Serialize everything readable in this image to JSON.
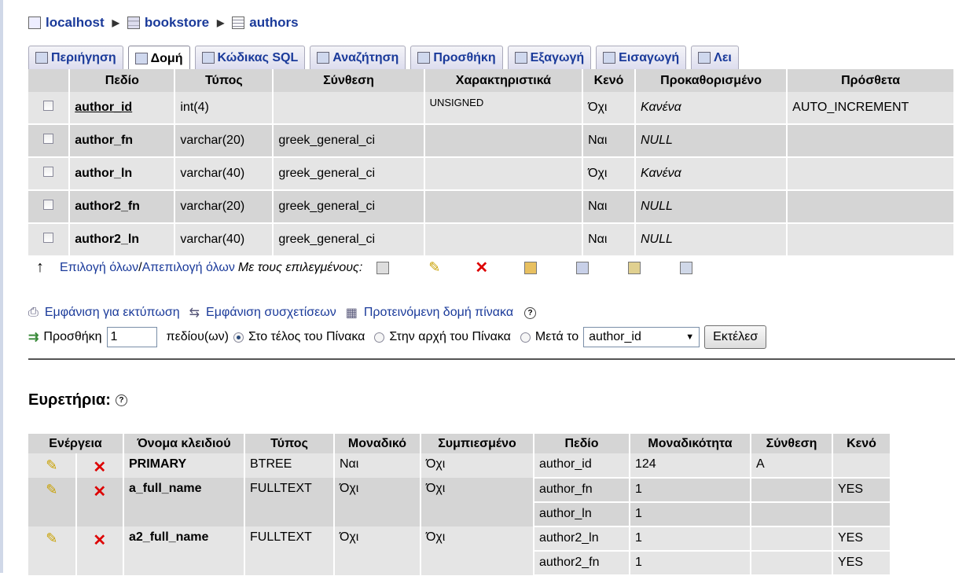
{
  "breadcrumb": {
    "server": "localhost",
    "database": "bookstore",
    "table": "authors"
  },
  "tabs": [
    {
      "label": "Περιήγηση",
      "icon": "browse-icon"
    },
    {
      "label": "Δομή",
      "icon": "structure-icon",
      "active": true
    },
    {
      "label": "Κώδικας SQL",
      "icon": "sql-icon"
    },
    {
      "label": "Αναζήτηση",
      "icon": "search-icon"
    },
    {
      "label": "Προσθήκη",
      "icon": "insert-icon"
    },
    {
      "label": "Εξαγωγή",
      "icon": "export-icon"
    },
    {
      "label": "Εισαγωγή",
      "icon": "import-icon"
    },
    {
      "label": "Λει",
      "icon": "operations-icon"
    }
  ],
  "structure": {
    "headers": [
      "Πεδίο",
      "Τύπος",
      "Σύνθεση",
      "Χαρακτηριστικά",
      "Κενό",
      "Προκαθορισμένο",
      "Πρόσθετα"
    ],
    "rows": [
      {
        "field": "author_id",
        "type": "int(4)",
        "collation": "",
        "attributes": "UNSIGNED",
        "null": "Όχι",
        "default": "Κανένα",
        "extra": "AUTO_INCREMENT"
      },
      {
        "field": "author_fn",
        "type": "varchar(20)",
        "collation": "greek_general_ci",
        "attributes": "",
        "null": "Ναι",
        "default": "NULL",
        "extra": ""
      },
      {
        "field": "author_ln",
        "type": "varchar(40)",
        "collation": "greek_general_ci",
        "attributes": "",
        "null": "Όχι",
        "default": "Κανένα",
        "extra": ""
      },
      {
        "field": "author2_fn",
        "type": "varchar(20)",
        "collation": "greek_general_ci",
        "attributes": "",
        "null": "Ναι",
        "default": "NULL",
        "extra": ""
      },
      {
        "field": "author2_ln",
        "type": "varchar(40)",
        "collation": "greek_general_ci",
        "attributes": "",
        "null": "Ναι",
        "default": "NULL",
        "extra": ""
      }
    ]
  },
  "actions": {
    "select_all": "Επιλογή όλων",
    "separator": " / ",
    "deselect_all": "Απεπιλογή όλων",
    "with_selected": "Με τους επιλεγμένους:"
  },
  "links": {
    "print": "Εμφάνιση για εκτύπωση",
    "relations": "Εμφάνιση συσχετίσεων",
    "propose": "Προτεινόμενη δομή πίνακα"
  },
  "add_fields": {
    "label": "Προσθήκη",
    "count": "1",
    "fields_label": "πεδίου(ων)",
    "at_end": "Στο τέλος του Πίνακα",
    "at_start": "Στην αρχή του Πίνακα",
    "after": "Μετά το",
    "after_field": "author_id",
    "go": "Εκτέλεσ"
  },
  "indexes": {
    "title": "Ευρετήρια:",
    "headers": [
      "Ενέργεια",
      "Όνομα κλειδιού",
      "Τύπος",
      "Μοναδικό",
      "Συμπιεσμένο",
      "Πεδίο",
      "Μοναδικότητα",
      "Σύνθεση",
      "Κενό"
    ],
    "rows": [
      {
        "name": "PRIMARY",
        "type": "BTREE",
        "unique": "Ναι",
        "packed": "Όχι",
        "fields": [
          {
            "field": "author_id",
            "cardinality": "124",
            "collation": "A",
            "null": ""
          }
        ]
      },
      {
        "name": "a_full_name",
        "type": "FULLTEXT",
        "unique": "Όχι",
        "packed": "Όχι",
        "fields": [
          {
            "field": "author_fn",
            "cardinality": "1",
            "collation": "",
            "null": "YES"
          },
          {
            "field": "author_ln",
            "cardinality": "1",
            "collation": "",
            "null": ""
          }
        ]
      },
      {
        "name": "a2_full_name",
        "type": "FULLTEXT",
        "unique": "Όχι",
        "packed": "Όχι",
        "fields": [
          {
            "field": "author2_ln",
            "cardinality": "1",
            "collation": "",
            "null": "YES"
          },
          {
            "field": "author2_fn",
            "cardinality": "1",
            "collation": "",
            "null": "YES"
          }
        ]
      }
    ]
  }
}
